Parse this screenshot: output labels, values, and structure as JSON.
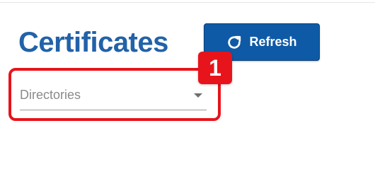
{
  "header": {
    "title": "Certificates",
    "refresh_label": "Refresh",
    "refresh_icon": "refresh-icon"
  },
  "filters": {
    "directories_placeholder": "Directories",
    "dropdown_icon": "chevron-down-icon"
  },
  "annotation": {
    "step_number": "1",
    "highlight_color": "#e8141b"
  },
  "colors": {
    "title": "#2262a8",
    "button": "#0f5aa6"
  }
}
